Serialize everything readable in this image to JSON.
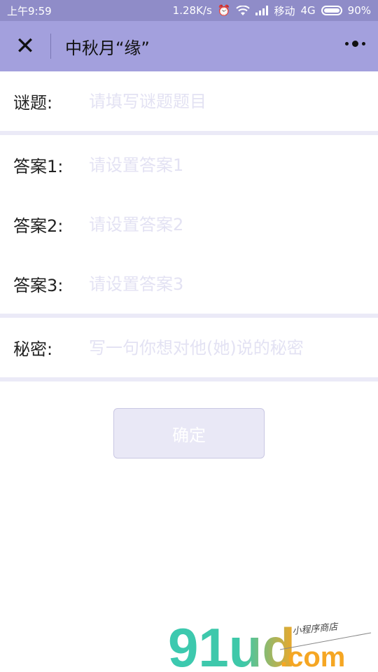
{
  "status_bar": {
    "time": "上午9:59",
    "network_speed": "1.28K/s",
    "carrier": "移动",
    "network_type": "4G",
    "battery": "90%"
  },
  "nav": {
    "title": "中秋月“缘”"
  },
  "form": {
    "riddle": {
      "label": "谜题:",
      "placeholder": "请填写谜题题目"
    },
    "answer1": {
      "label": "答案1:",
      "placeholder": "请设置答案1"
    },
    "answer2": {
      "label": "答案2:",
      "placeholder": "请设置答案2"
    },
    "answer3": {
      "label": "答案3:",
      "placeholder": "请设置答案3"
    },
    "secret": {
      "label": "秘密:",
      "placeholder": "写一句你想对他(她)说的秘密"
    }
  },
  "confirm_button": {
    "label": "确定"
  },
  "watermark": {
    "brand": "91ud",
    "domain": ".com",
    "tagline": "小程序商店"
  },
  "colors": {
    "nav_bg": "#a3a0dd",
    "status_bg": "#8f8cc8",
    "separator": "#ebeaf7",
    "placeholder": "#e3e2f3",
    "button_bg": "#e9e8f6"
  }
}
